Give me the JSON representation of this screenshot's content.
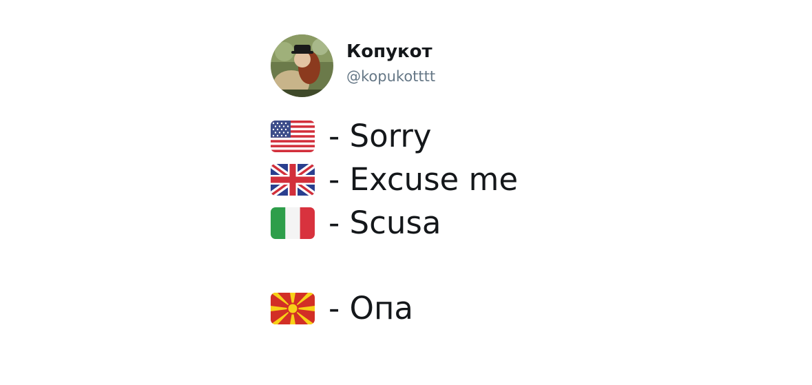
{
  "user": {
    "display_name": "Копукот",
    "handle": "@kopukotttt"
  },
  "tweet": {
    "lines": [
      {
        "flag": "us-flag-icon",
        "text": "- Sorry"
      },
      {
        "flag": "uk-flag-icon",
        "text": "- Excuse me"
      },
      {
        "flag": "italy-flag-icon",
        "text": "- Scusa"
      },
      {
        "flag": "north-macedonia-flag-icon",
        "text": "- Опа"
      }
    ]
  },
  "colors": {
    "name": "#14171a",
    "handle": "#657786",
    "background": "#ffffff"
  }
}
